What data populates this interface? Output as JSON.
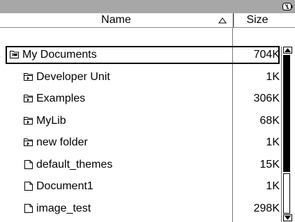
{
  "columns": {
    "name": "Name",
    "size": "Size"
  },
  "rows": [
    {
      "name": "My Documents",
      "size": "704K",
      "type": "folder-open",
      "icon": "folder-open-icon"
    },
    {
      "name": "Developer Unit",
      "size": "1K",
      "type": "folder-closed",
      "icon": "folder-closed-icon"
    },
    {
      "name": "Examples",
      "size": "306K",
      "type": "folder-closed",
      "icon": "folder-closed-icon"
    },
    {
      "name": "MyLib",
      "size": "68K",
      "type": "folder-closed",
      "icon": "folder-closed-icon"
    },
    {
      "name": "new folder",
      "size": "1K",
      "type": "folder-closed",
      "icon": "folder-closed-icon"
    },
    {
      "name": "default_themes",
      "size": "15K",
      "type": "document",
      "icon": "document-icon"
    },
    {
      "name": "Document1",
      "size": "1K",
      "type": "document",
      "icon": "document-icon"
    },
    {
      "name": "image_test",
      "size": "298K",
      "type": "document",
      "icon": "document-icon"
    }
  ],
  "selected_index": 0,
  "colors": {
    "titlebar": "#a7a7a7",
    "selection_border": "#000000"
  }
}
